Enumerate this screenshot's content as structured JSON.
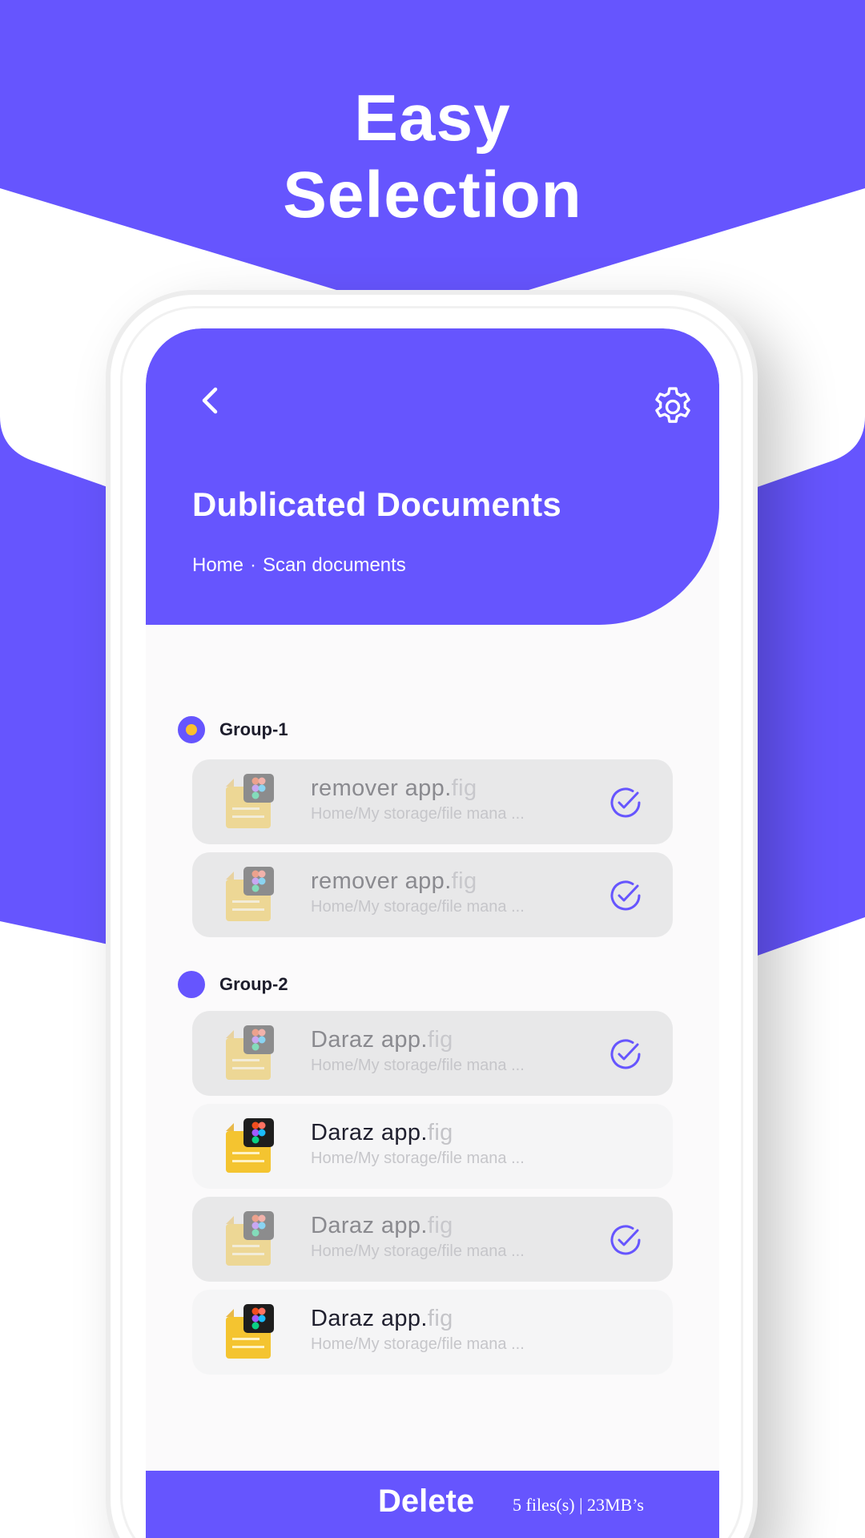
{
  "promo": {
    "line1": "Easy",
    "line2": "Selection"
  },
  "colors": {
    "brand": "#6655fe",
    "accent": "#fbc02d",
    "selected_card": "#e8e8e9",
    "card": "#f5f5f6"
  },
  "header": {
    "back_icon": "chevron-left-icon",
    "settings_icon": "gear-icon",
    "title": "Dublicated Documents",
    "breadcrumb": {
      "home": "Home",
      "separator": "·",
      "current": "Scan documents"
    }
  },
  "groups": [
    {
      "label": "Group-1",
      "files": [
        {
          "name": "remover app.",
          "ext": "fig",
          "path": "Home/My storage/file mana ...",
          "selected": true
        },
        {
          "name": "remover app.",
          "ext": "fig",
          "path": "Home/My storage/file mana ...",
          "selected": true
        }
      ]
    },
    {
      "label": "Group-2",
      "files": [
        {
          "name": "Daraz app.",
          "ext": "fig",
          "path": "Home/My storage/file mana ...",
          "selected": true
        },
        {
          "name": "Daraz app.",
          "ext": "fig",
          "path": "Home/My storage/file mana ...",
          "selected": false
        },
        {
          "name": "Daraz app.",
          "ext": "fig",
          "path": "Home/My storage/file mana ...",
          "selected": true
        },
        {
          "name": "Daraz app.",
          "ext": "fig",
          "path": "Home/My storage/file mana ...",
          "selected": false
        }
      ]
    }
  ],
  "footer": {
    "delete_label": "Delete",
    "info": "5 files(s) | 23MB’s"
  }
}
